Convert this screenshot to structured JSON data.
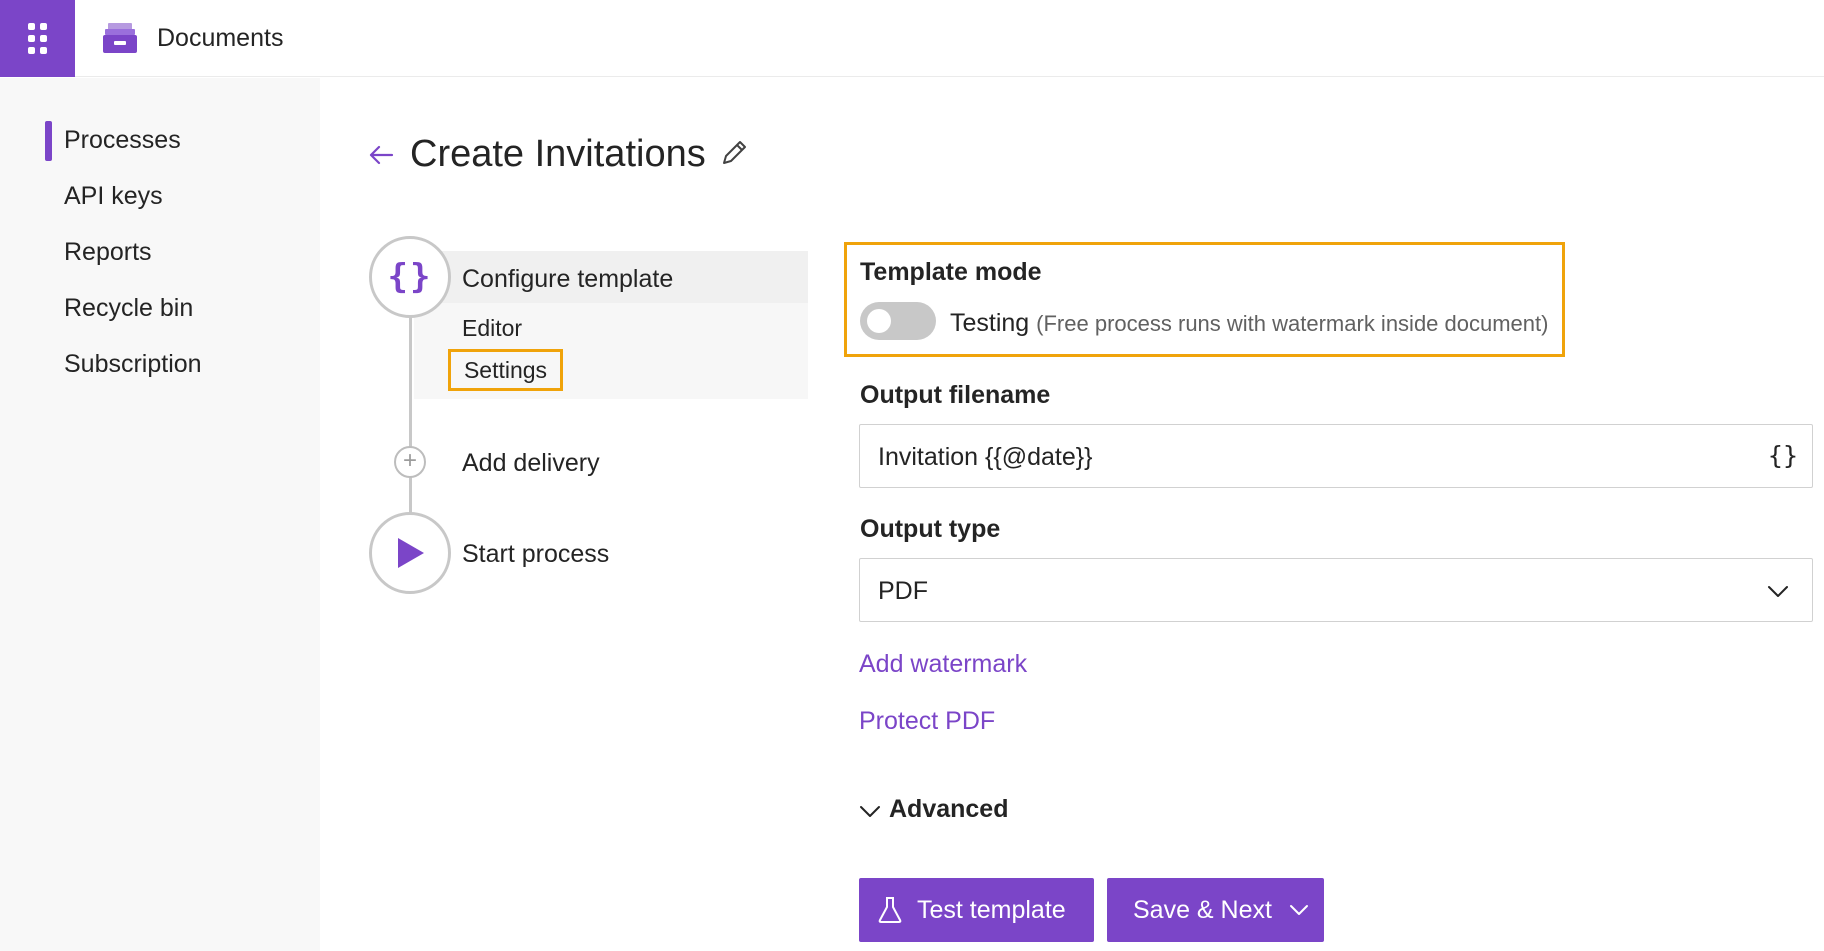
{
  "app": {
    "title": "Documents"
  },
  "nav": {
    "items": [
      {
        "label": "Processes",
        "active": true
      },
      {
        "label": "API keys",
        "active": false
      },
      {
        "label": "Reports",
        "active": false
      },
      {
        "label": "Recycle bin",
        "active": false
      },
      {
        "label": "Subscription",
        "active": false
      }
    ]
  },
  "header": {
    "title": "Create Invitations"
  },
  "steps": {
    "configure": {
      "label": "Configure template",
      "icon": "braces-icon",
      "sub": [
        "Editor",
        "Settings"
      ],
      "active_sub": "Settings"
    },
    "delivery": {
      "label": "Add delivery",
      "icon": "plus-icon"
    },
    "start": {
      "label": "Start process",
      "icon": "play-icon"
    }
  },
  "form": {
    "template_mode": {
      "label": "Template mode",
      "toggle_on": false,
      "value": "Testing",
      "note": "(Free process runs with watermark inside document)"
    },
    "output_filename": {
      "label": "Output filename",
      "value": "Invitation {{@date}}",
      "var_icon": "{}"
    },
    "output_type": {
      "label": "Output type",
      "value": "PDF"
    },
    "links": {
      "watermark": "Add watermark",
      "protect": "Protect PDF"
    },
    "advanced": {
      "label": "Advanced"
    }
  },
  "actions": {
    "test": "Test template",
    "save": "Save & Next"
  },
  "colors": {
    "accent": "#7b45c8",
    "highlight": "#f0a30a",
    "nav_bg": "#f8f8f8"
  }
}
